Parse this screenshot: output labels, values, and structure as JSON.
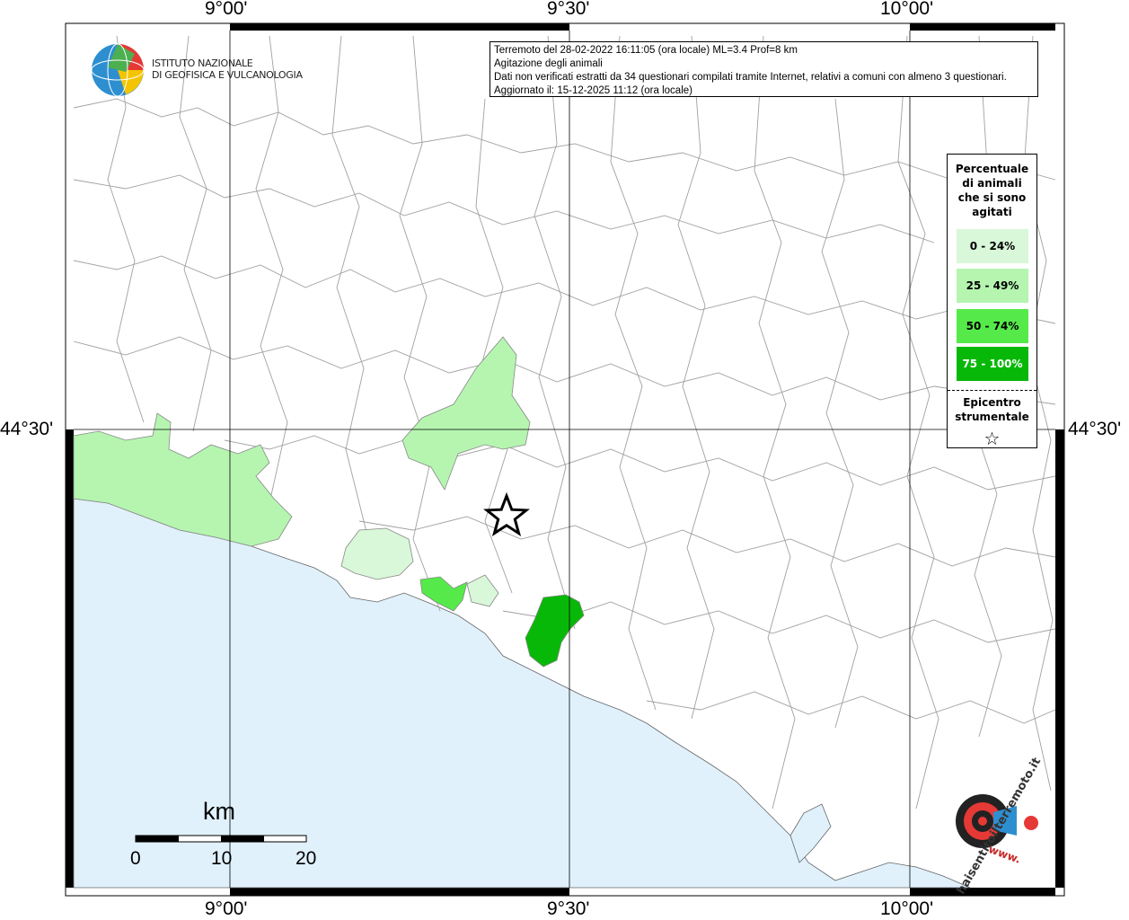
{
  "coordinates": {
    "top": [
      "9°00'",
      "9°30'",
      "10°00'"
    ],
    "bottom": [
      "9°00'",
      "9°30'",
      "10°00'"
    ],
    "left": "44°30'",
    "right": "44°30'"
  },
  "institute": {
    "line1": "ISTITUTO NAZIONALE",
    "line2": "DI GEOFISICA E VULCANOLOGIA"
  },
  "info": {
    "line1": "Terremoto del 28-02-2022 16:11:05 (ora locale) ML=3.4 Prof=8 km",
    "line2": "Agitazione degli animali",
    "line3": "Dati non verificati estratti da 34 questionari compilati tramite Internet, relativi a comuni con almeno 3 questionari.",
    "line4": "Aggiornato il: 15-12-2025 11:12 (ora locale)"
  },
  "legend": {
    "title": [
      "Percentuale",
      "di animali",
      "che si sono",
      "agitati"
    ],
    "classes": [
      {
        "label": "0 - 24%",
        "color": "#d9f7d9",
        "text_color": "#000000"
      },
      {
        "label": "25 - 49%",
        "color": "#b5f5b0",
        "text_color": "#000000"
      },
      {
        "label": "50 - 74%",
        "color": "#55ea4a",
        "text_color": "#000000"
      },
      {
        "label": "75 - 100%",
        "color": "#08b808",
        "text_color": "#ffffff"
      }
    ],
    "epicenter": [
      "Epicentro",
      "strumentale"
    ],
    "star_icon": "star-icon"
  },
  "scale": {
    "unit": "km",
    "ticks": [
      "0",
      "10",
      "20"
    ]
  },
  "colors": {
    "sea": "#e0f1fc",
    "land": "#ffffff",
    "borders": "#9a9a9a"
  },
  "watermark": {
    "text": "haisentitoilterremoto.it",
    "url_text": "www."
  }
}
